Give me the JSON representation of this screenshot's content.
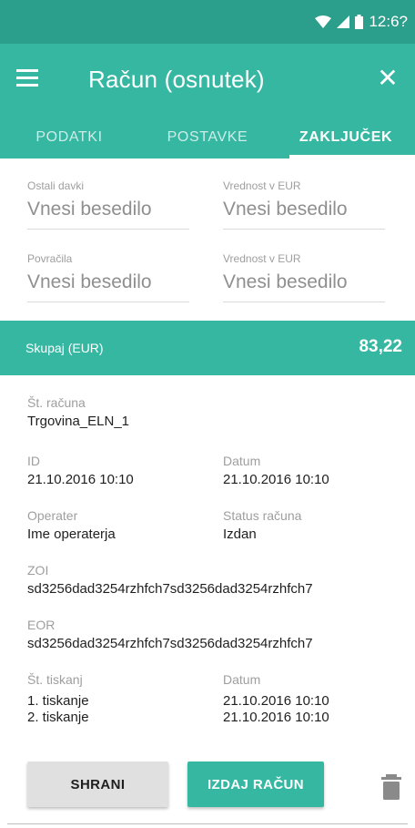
{
  "status_bar": {
    "time": "12:6?"
  },
  "app_bar": {
    "title": "Račun (osnutek)"
  },
  "tabs": [
    {
      "label": "PODATKI"
    },
    {
      "label": "POSTAVKE"
    },
    {
      "label": "ZAKLJUČEK"
    }
  ],
  "form": {
    "other_taxes": {
      "label": "Ostali davki",
      "placeholder": "Vnesi besedilo"
    },
    "other_taxes_value": {
      "label": "Vrednost v EUR",
      "placeholder": "Vnesi besedilo"
    },
    "refunds": {
      "label": "Povračila",
      "placeholder": "Vnesi besedilo"
    },
    "refunds_value": {
      "label": "Vrednost v EUR",
      "placeholder": "Vnesi besedilo"
    }
  },
  "total": {
    "label": "Skupaj (EUR)",
    "value": "83,22"
  },
  "details": {
    "invoice_number": {
      "label": "Št. računa",
      "value": "Trgovina_ELN_1"
    },
    "id": {
      "label": "ID",
      "value": "21.10.2016  10:10"
    },
    "date": {
      "label": "Datum",
      "value": "21.10.2016  10:10"
    },
    "operator": {
      "label": "Operater",
      "value": "Ime operaterja"
    },
    "status": {
      "label": "Status računa",
      "value": "Izdan"
    },
    "zoi": {
      "label": "ZOI",
      "value": "sd3256dad3254rzhfch7sd3256dad3254rzhfch7"
    },
    "eor": {
      "label": "EOR",
      "value": "sd3256dad3254rzhfch7sd3256dad3254rzhfch7"
    },
    "prints": {
      "label": "Št. tiskanj",
      "items": [
        "1. tiskanje",
        "2. tiskanje"
      ]
    },
    "print_dates": {
      "label": "Datum",
      "items": [
        "21.10.2016  10:10",
        "21.10.2016  10:10"
      ]
    }
  },
  "actions": {
    "save_label": "SHRANI",
    "issue_label": "IZDAJ RAČUN"
  },
  "colors": {
    "primary": "#35b7a2",
    "primary_dark": "#2c9e8c"
  }
}
